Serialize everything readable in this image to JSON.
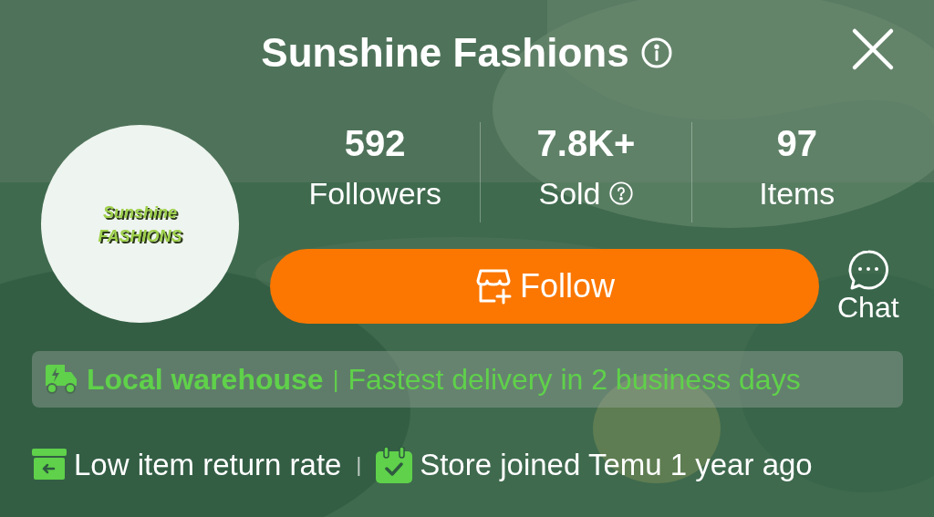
{
  "header": {
    "title": "Sunshine Fashions"
  },
  "store": {
    "logo_lines": [
      "Sunshine",
      "FASHIONS"
    ]
  },
  "stats": [
    {
      "value": "592",
      "label": "Followers",
      "help": false
    },
    {
      "value": "7.8K+",
      "label": "Sold",
      "help": true
    },
    {
      "value": "97",
      "label": "Items",
      "help": false
    }
  ],
  "follow_button": {
    "label": "Follow"
  },
  "chat_button": {
    "label": "Chat"
  },
  "delivery_banner": {
    "highlight": "Local warehouse",
    "separator": "|",
    "detail": "Fastest delivery in 2 business days"
  },
  "badges": [
    {
      "kind": "return",
      "label": "Low item return rate"
    },
    {
      "kind": "joined",
      "label": "Store joined Temu 1 year ago"
    }
  ],
  "badge_separator": "|"
}
